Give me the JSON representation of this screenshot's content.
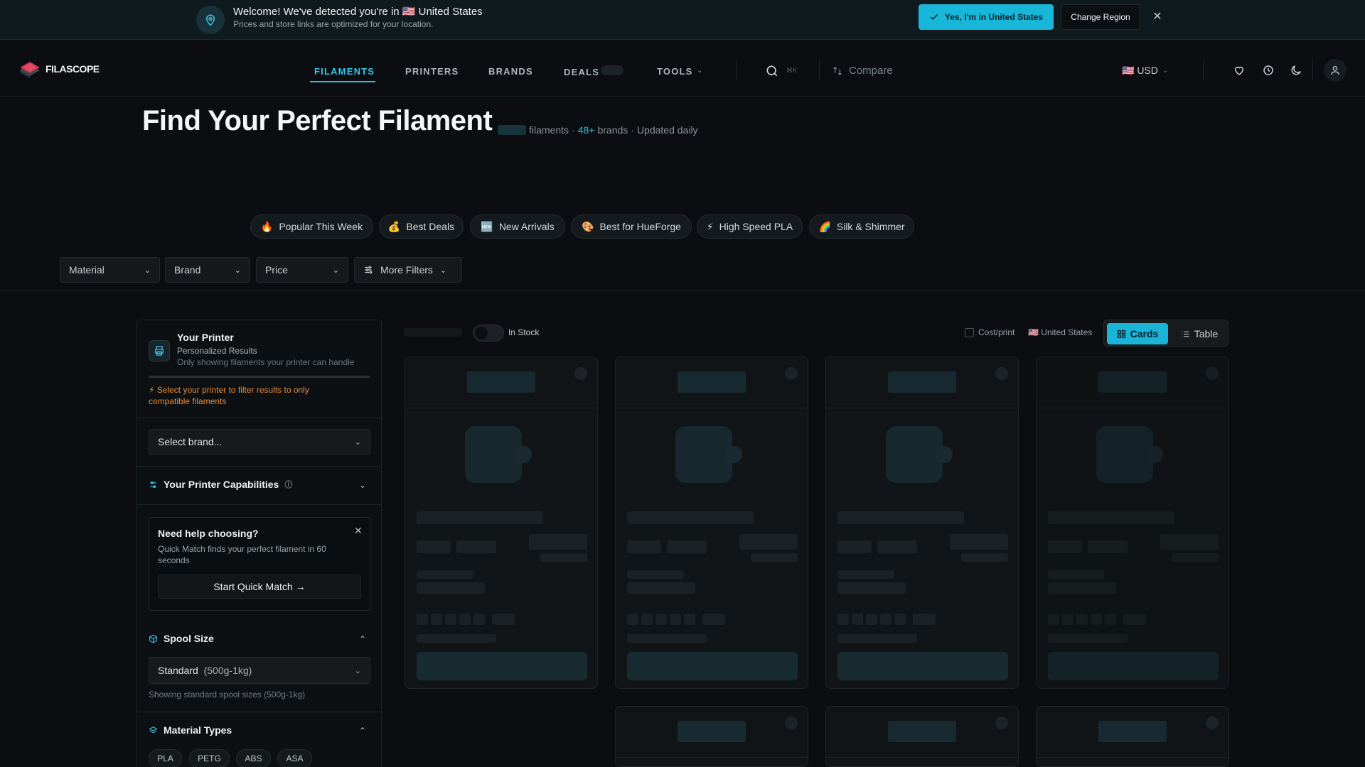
{
  "banner": {
    "welcome": "Welcome! We've detected you're in 🇺🇸 United States",
    "subtitle": "Prices and store links are optimized for your location.",
    "confirm_label": "Yes, I'm in United States",
    "change_label": "Change Region",
    "close_icon": "close-icon"
  },
  "header": {
    "brand": "FILASCOPE",
    "nav": [
      "FILAMENTS",
      "PRINTERS",
      "BRANDS",
      "DEALS",
      "TOOLS"
    ],
    "active_nav": "FILAMENTS",
    "search_shortcut": "⌘K",
    "compare_label": "Compare",
    "currency": "🇺🇸 USD"
  },
  "hero": {
    "title": "Find Your Perfect Filament",
    "filaments_label": "filaments",
    "brands_count": "48+",
    "brands_label": "brands",
    "updated": "Updated daily",
    "sep": "·"
  },
  "chips": [
    {
      "emoji": "🔥",
      "label": "Popular This Week"
    },
    {
      "emoji": "💰",
      "label": "Best Deals"
    },
    {
      "emoji": "🆕",
      "label": "New Arrivals"
    },
    {
      "emoji": "🎨",
      "label": "Best for HueForge"
    },
    {
      "emoji": "⚡",
      "label": "High Speed PLA"
    },
    {
      "emoji": "🌈",
      "label": "Silk & Shimmer"
    }
  ],
  "filters": {
    "material": "Material",
    "brand": "Brand",
    "price": "Price",
    "more": "More Filters"
  },
  "sidebar": {
    "printer_title": "Your Printer",
    "printer_sub1": "Personalized Results",
    "printer_sub2": "Only showing filaments your printer can handle",
    "warning": "⚡ Select your printer to filter results to only compatible filaments",
    "brand_select": "Select brand...",
    "capabilities": "Your Printer Capabilities",
    "help_title": "Need help choosing?",
    "help_text": "Quick Match finds your perfect filament in 60 seconds",
    "help_button": "Start Quick Match →",
    "spool_title": "Spool Size",
    "spool_value": "Standard",
    "spool_range": "(500g-1kg)",
    "spool_note": "Showing standard spool sizes (500g-1kg)",
    "material_title": "Material Types",
    "materials": [
      "PLA",
      "PETG",
      "ABS",
      "ASA"
    ]
  },
  "toolbar": {
    "in_stock": "In Stock",
    "cost_print": "Cost/print",
    "region": "🇺🇸 United States",
    "cards_label": "Cards",
    "table_label": "Table"
  },
  "colors": {
    "accent": "#1ab4d8",
    "warning": "#e78a3b",
    "background": "#0b0d10"
  }
}
